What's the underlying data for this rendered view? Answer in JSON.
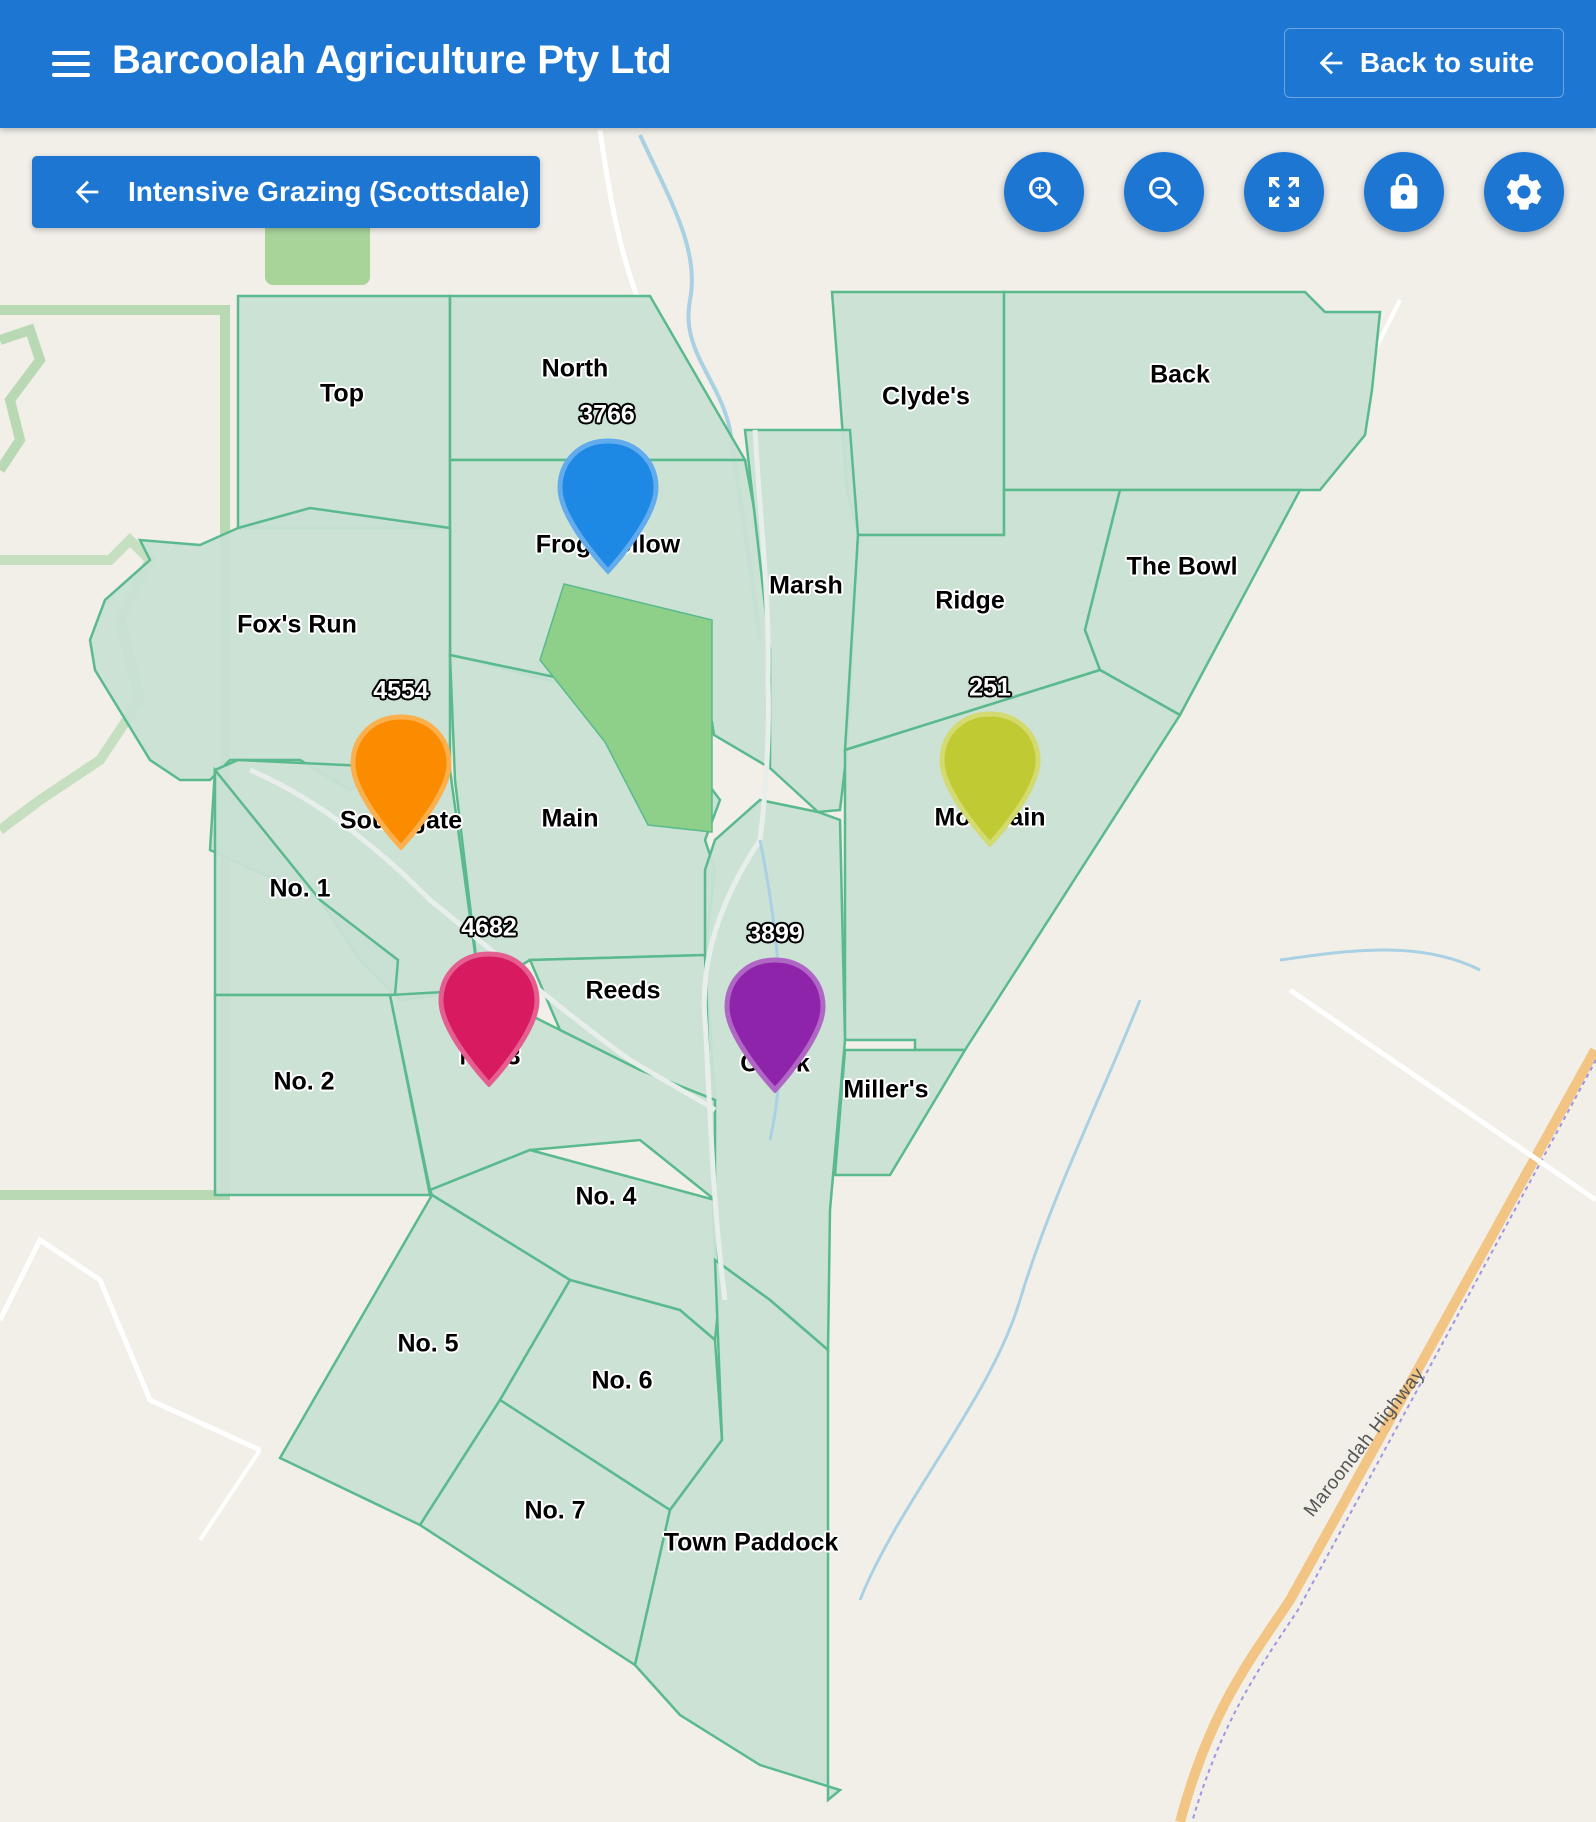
{
  "appbar": {
    "title": "Barcoolah Agriculture Pty Ltd",
    "back_label": "Back to suite"
  },
  "map": {
    "group_button_label": "Intensive Grazing (Scottsdale)",
    "controls": [
      "zoom-in-icon",
      "zoom-out-icon",
      "fullscreen-icon",
      "lock-icon",
      "settings-icon"
    ],
    "road_label": "Maroondah Highway",
    "paddocks": [
      "Top",
      "North",
      "Clyde's",
      "Back",
      "Frog Hollow",
      "Marsh",
      "Ridge",
      "The Bowl",
      "Fox's Run",
      "Southgate",
      "Main",
      "Mountain",
      "No. 1",
      "Reeds",
      "Creek",
      "Miller's",
      "No. 2",
      "No. 3",
      "No. 4",
      "No. 5",
      "No. 6",
      "No. 7",
      "Town Paddock"
    ],
    "markers": [
      {
        "count": "3766",
        "color": "#1e88e5"
      },
      {
        "count": "4554",
        "color": "#fb8c00"
      },
      {
        "count": "251",
        "color": "#c0ca33"
      },
      {
        "count": "4682",
        "color": "#d81b60"
      },
      {
        "count": "3899",
        "color": "#8e24aa"
      }
    ]
  }
}
